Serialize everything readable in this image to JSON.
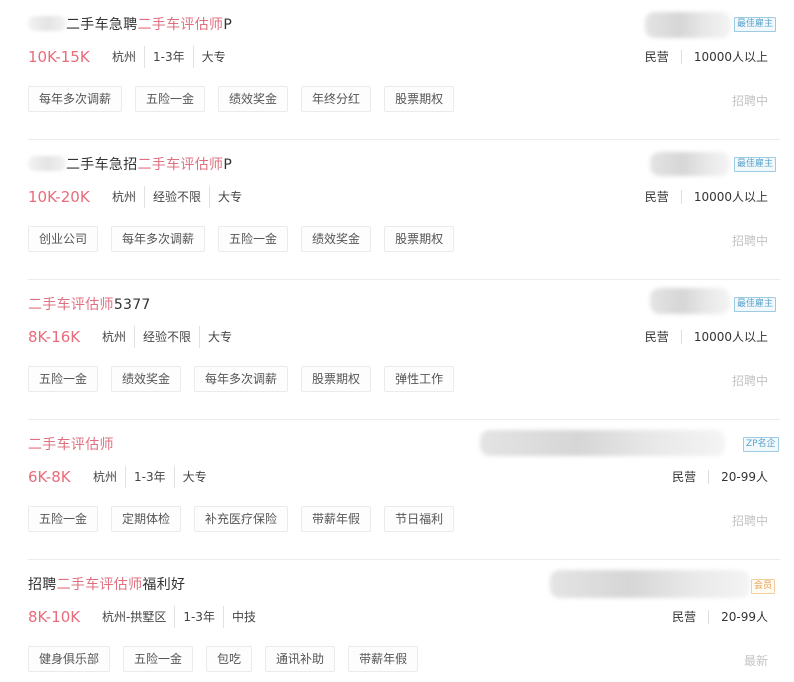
{
  "jobs": [
    {
      "title_prefix": "二手车急聘",
      "title_highlight": "二手车评估师",
      "title_suffix": "P",
      "salary": "10K-15K",
      "meta": [
        "杭州",
        "1-3年",
        "大专"
      ],
      "tags": [
        "每年多次调薪",
        "五险一金",
        "绩效奖金",
        "年终分红",
        "股票期权"
      ],
      "badge": "最佳雇主",
      "company_type": "民营",
      "company_size": "10000人以上",
      "status": "招聘中"
    },
    {
      "title_prefix": "二手车急招",
      "title_highlight": "二手车评估师",
      "title_suffix": "P",
      "salary": "10K-20K",
      "meta": [
        "杭州",
        "经验不限",
        "大专"
      ],
      "tags": [
        "创业公司",
        "每年多次调薪",
        "五险一金",
        "绩效奖金",
        "股票期权"
      ],
      "badge": "最佳雇主",
      "company_type": "民营",
      "company_size": "10000人以上",
      "status": "招聘中"
    },
    {
      "title_prefix": "",
      "title_highlight": "二手车评估师",
      "title_suffix": "5377",
      "salary": "8K-16K",
      "meta": [
        "杭州",
        "经验不限",
        "大专"
      ],
      "tags": [
        "五险一金",
        "绩效奖金",
        "每年多次调薪",
        "股票期权",
        "弹性工作"
      ],
      "badge": "最佳雇主",
      "company_type": "民营",
      "company_size": "10000人以上",
      "status": "招聘中"
    },
    {
      "title_prefix": "",
      "title_highlight": "二手车评估师",
      "title_suffix": "",
      "salary": "6K-8K",
      "meta": [
        "杭州",
        "1-3年",
        "大专"
      ],
      "tags": [
        "五险一金",
        "定期体检",
        "补充医疗保险",
        "带薪年假",
        "节日福利"
      ],
      "badge": "ZP名企",
      "company_type": "民营",
      "company_size": "20-99人",
      "status": "招聘中"
    },
    {
      "title_prefix": "招聘",
      "title_highlight": "二手车评估师",
      "title_suffix": "福利好",
      "salary": "8K-10K",
      "meta": [
        "杭州-拱墅区",
        "1-3年",
        "中技"
      ],
      "tags": [
        "健身俱乐部",
        "五险一金",
        "包吃",
        "通讯补助",
        "带薪年假"
      ],
      "badge": "会员",
      "company_type": "民营",
      "company_size": "20-99人",
      "status": "最新"
    }
  ],
  "colors": {
    "highlight": "#e0707f",
    "salary": "#e86c7a",
    "badge_blue": "#5aa2c8",
    "badge_orange": "#e8a14c",
    "status": "#c4c4c4"
  }
}
